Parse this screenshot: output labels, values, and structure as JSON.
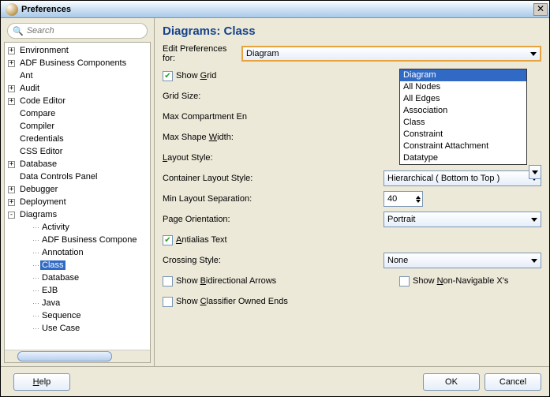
{
  "window": {
    "title": "Preferences"
  },
  "search": {
    "placeholder": "Search"
  },
  "tree": [
    {
      "label": "Environment",
      "exp": "+",
      "child": false
    },
    {
      "label": "ADF Business Components",
      "exp": "+",
      "child": false
    },
    {
      "label": "Ant",
      "exp": "",
      "child": false
    },
    {
      "label": "Audit",
      "exp": "+",
      "child": false
    },
    {
      "label": "Code Editor",
      "exp": "+",
      "child": false
    },
    {
      "label": "Compare",
      "exp": "",
      "child": false
    },
    {
      "label": "Compiler",
      "exp": "",
      "child": false
    },
    {
      "label": "Credentials",
      "exp": "",
      "child": false
    },
    {
      "label": "CSS Editor",
      "exp": "",
      "child": false
    },
    {
      "label": "Database",
      "exp": "+",
      "child": false
    },
    {
      "label": "Data Controls Panel",
      "exp": "",
      "child": false
    },
    {
      "label": "Debugger",
      "exp": "+",
      "child": false
    },
    {
      "label": "Deployment",
      "exp": "+",
      "child": false
    },
    {
      "label": "Diagrams",
      "exp": "-",
      "child": false
    },
    {
      "label": "Activity",
      "exp": "",
      "child": true
    },
    {
      "label": "ADF Business Compone",
      "exp": "",
      "child": true
    },
    {
      "label": "Annotation",
      "exp": "",
      "child": true
    },
    {
      "label": "Class",
      "exp": "",
      "child": true,
      "selected": true
    },
    {
      "label": "Database",
      "exp": "",
      "child": true
    },
    {
      "label": "EJB",
      "exp": "",
      "child": true
    },
    {
      "label": "Java",
      "exp": "",
      "child": true
    },
    {
      "label": "Sequence",
      "exp": "",
      "child": true
    },
    {
      "label": "Use Case",
      "exp": "",
      "child": true
    }
  ],
  "page": {
    "heading": "Diagrams: Class",
    "editPrefLabel": "Edit Preferences for:",
    "editPrefValue": "Diagram",
    "dropdownOptions": [
      "Diagram",
      "All Nodes",
      "All Edges",
      "Association",
      "Class",
      "Constraint",
      "Constraint Attachment",
      "Datatype"
    ],
    "showGrid": {
      "label": "Show Grid",
      "checked": true
    },
    "gridSize": "Grid Size:",
    "maxComp": "Max Compartment En",
    "maxShape": "Max Shape Width:",
    "layoutStyle": "Layout Style:",
    "containerLayout": {
      "label": "Container Layout Style:",
      "value": "Hierarchical ( Bottom to Top )"
    },
    "minSep": {
      "label": "Min Layout Separation:",
      "value": "40"
    },
    "pageOrient": {
      "label": "Page Orientation:",
      "value": "Portrait"
    },
    "antialias": {
      "label": "Antialias Text",
      "checked": true
    },
    "crossing": {
      "label": "Crossing Style:",
      "value": "None"
    },
    "showBidir": {
      "label": "Show Bidirectional Arrows",
      "checked": false
    },
    "showNonNav": {
      "label": "Show Non-Navigable X's",
      "checked": false
    },
    "showClassifier": {
      "label": "Show Classifier Owned Ends",
      "checked": false
    }
  },
  "buttons": {
    "help": "Help",
    "ok": "OK",
    "cancel": "Cancel"
  }
}
